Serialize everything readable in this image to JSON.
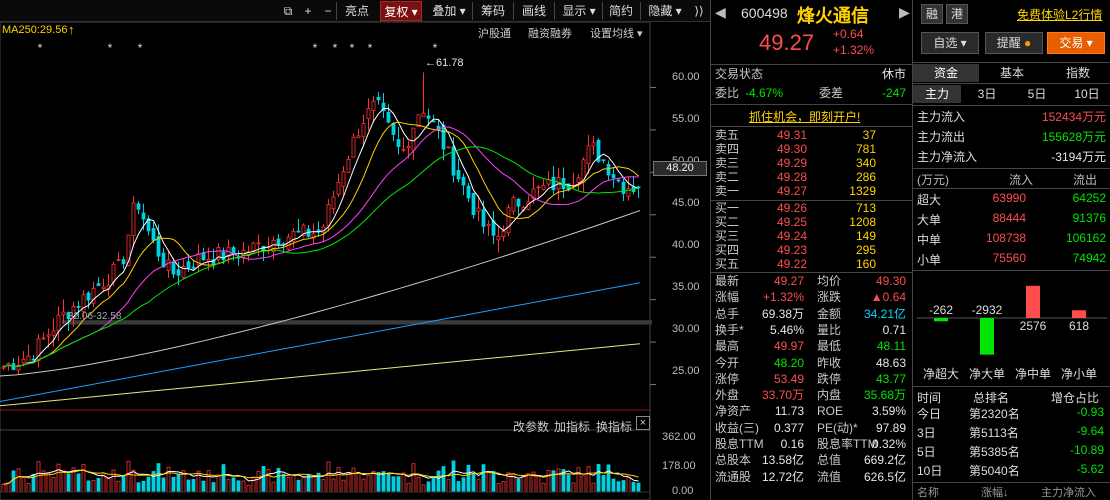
{
  "toolbar": {
    "items": [
      "亮点",
      "复权",
      "叠加",
      "筹码",
      "画线",
      "显示",
      "简约",
      "隐藏"
    ],
    "selected": "复权",
    "icons": [
      "copy-icon",
      "plus-icon",
      "minus-icon"
    ]
  },
  "chart": {
    "ma_label": "MA250:29.56",
    "links": [
      "沪股通",
      "融资融券",
      "设置均线"
    ],
    "peak_label": "61.78",
    "current_price_tag": "48.20",
    "range_label": "32.06-32.58",
    "volume_links": [
      "改参数",
      "加指标",
      "换指标"
    ],
    "price_axis": [
      "60.00",
      "55.00",
      "50.00",
      "45.00",
      "40.00",
      "35.00",
      "30.00",
      "25.00"
    ],
    "volume_axis": [
      "362.00",
      "178.00",
      "0.00"
    ],
    "star_count": 8
  },
  "chart_data": {
    "type": "candlestick",
    "ylim": [
      22,
      63
    ],
    "peak": 61.78,
    "last_close": 48.2,
    "moving_averages": [
      "MA5",
      "MA10",
      "MA20",
      "MA30",
      "MA60",
      "MA120",
      "MA250"
    ]
  },
  "quote": {
    "code": "600498",
    "name": "烽火通信",
    "price": "49.27",
    "change": "+0.64",
    "change_pct": "+1.32%",
    "buttons": [
      "融",
      "港"
    ],
    "status_label": "交易状态",
    "status_value": "休市",
    "weibi_label": "委比",
    "weibi": "-4.67%",
    "weicha_label": "委差",
    "weicha": "-247",
    "promo": "抓住机会，即刻开户!",
    "asks": [
      {
        "label": "卖五",
        "price": "49.31",
        "vol": "37"
      },
      {
        "label": "卖四",
        "price": "49.30",
        "vol": "781"
      },
      {
        "label": "卖三",
        "price": "49.29",
        "vol": "340"
      },
      {
        "label": "卖二",
        "price": "49.28",
        "vol": "286"
      },
      {
        "label": "卖一",
        "price": "49.27",
        "vol": "1329"
      }
    ],
    "bids": [
      {
        "label": "买一",
        "price": "49.26",
        "vol": "713"
      },
      {
        "label": "买二",
        "price": "49.25",
        "vol": "1208"
      },
      {
        "label": "买三",
        "price": "49.24",
        "vol": "149"
      },
      {
        "label": "买四",
        "price": "49.23",
        "vol": "295"
      },
      {
        "label": "买五",
        "price": "49.22",
        "vol": "160"
      }
    ],
    "stats": [
      {
        "l1": "最新",
        "v1": "49.27",
        "c1": "up",
        "l2": "均价",
        "v2": "49.30",
        "c2": "up"
      },
      {
        "l1": "涨幅",
        "v1": "+1.32%",
        "c1": "up",
        "l2": "涨跌",
        "v2": "▲0.64",
        "c2": "up"
      },
      {
        "l1": "总手",
        "v1": "69.38万",
        "c1": "wh",
        "l2": "金额",
        "v2": "34.21亿",
        "c2": "cy"
      },
      {
        "l1": "换手*",
        "v1": "5.46%",
        "c1": "wh",
        "l2": "量比",
        "v2": "0.71",
        "c2": "wh"
      },
      {
        "l1": "最高",
        "v1": "49.97",
        "c1": "up",
        "l2": "最低",
        "v2": "48.11",
        "c2": "dn"
      },
      {
        "l1": "今开",
        "v1": "48.20",
        "c1": "dn",
        "l2": "昨收",
        "v2": "48.63",
        "c2": "wh"
      },
      {
        "l1": "涨停",
        "v1": "53.49",
        "c1": "up",
        "l2": "跌停",
        "v2": "43.77",
        "c2": "dn"
      },
      {
        "l1": "外盘",
        "v1": "33.70万",
        "c1": "up",
        "l2": "内盘",
        "v2": "35.68万",
        "c2": "dn"
      },
      {
        "l1": "净资产",
        "v1": "11.73",
        "c1": "wh",
        "l2": "ROE",
        "v2": "3.59%",
        "c2": "wh"
      },
      {
        "l1": "收益(三)",
        "v1": "0.377",
        "c1": "wh",
        "l2": "PE(动)*",
        "v2": "97.89",
        "c2": "wh"
      },
      {
        "l1": "股息TTM",
        "v1": "0.16",
        "c1": "wh",
        "l2": "股息率TTM",
        "v2": "0.32%",
        "c2": "wh"
      },
      {
        "l1": "总股本",
        "v1": "13.58亿",
        "c1": "wh",
        "l2": "总值",
        "v2": "669.2亿",
        "c2": "wh"
      },
      {
        "l1": "流通股",
        "v1": "12.72亿",
        "c1": "wh",
        "l2": "流值",
        "v2": "626.5亿",
        "c2": "wh"
      }
    ]
  },
  "right": {
    "top_link": "免费体验L2行情",
    "zixuan": "自选",
    "tixing": "提醒",
    "jiaoyi": "交易",
    "tabs": [
      "资金",
      "基本",
      "指数"
    ],
    "day_tabs": [
      "主力",
      "3日",
      "5日",
      "10日"
    ],
    "flow": [
      {
        "label": "主力流入",
        "value": "152434万元",
        "color": "up"
      },
      {
        "label": "主力流出",
        "value": "155628万元",
        "color": "dn"
      },
      {
        "label": "主力净流入",
        "value": "-3194万元",
        "color": "wh"
      }
    ],
    "table_header": [
      "(万元)",
      "流入",
      "流出"
    ],
    "table": [
      {
        "label": "超大",
        "in": "63990",
        "out": "64252"
      },
      {
        "label": "大单",
        "in": "88444",
        "out": "91376"
      },
      {
        "label": "中单",
        "in": "108738",
        "out": "106162"
      },
      {
        "label": "小单",
        "in": "75560",
        "out": "74942"
      }
    ],
    "net_bars": [
      {
        "label": "净超大",
        "value": -262,
        "text": "-262"
      },
      {
        "label": "净大单",
        "value": -2932,
        "text": "-2932"
      },
      {
        "label": "净中单",
        "value": 2576,
        "text": "2576"
      },
      {
        "label": "净小单",
        "value": 618,
        "text": "618"
      }
    ],
    "rank_header": [
      "时间",
      "总排名",
      "增仓占比"
    ],
    "ranks": [
      {
        "t": "今日",
        "r": "第2320名",
        "v": "-0.93"
      },
      {
        "t": "3日",
        "r": "第5113名",
        "v": "-9.64"
      },
      {
        "t": "5日",
        "r": "第5385名",
        "v": "-10.89"
      },
      {
        "t": "10日",
        "r": "第5040名",
        "v": "-5.62"
      }
    ],
    "footer": [
      "名称",
      "涨幅↓",
      "主力净流入"
    ]
  }
}
